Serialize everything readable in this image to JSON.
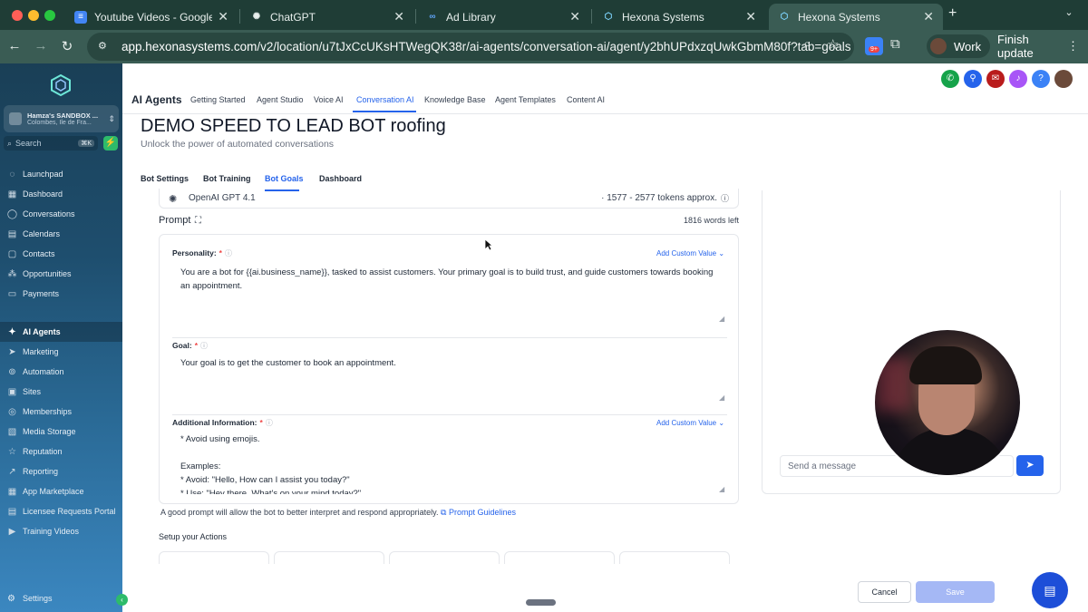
{
  "browser": {
    "tabs": [
      {
        "title": "Youtube Videos - Google Doc",
        "icon": "google-docs-icon",
        "color": "#4285f4"
      },
      {
        "title": "ChatGPT",
        "icon": "chatgpt-icon",
        "color": "#e8efed"
      },
      {
        "title": "Ad Library",
        "icon": "meta-icon",
        "color": "#3b82f6"
      },
      {
        "title": "Hexona Systems",
        "icon": "hexona-icon",
        "color": "#7dd3fc"
      },
      {
        "title": "Hexona Systems",
        "icon": "hexona-icon",
        "color": "#7dd3fc"
      }
    ],
    "url_host": "app.hexonasystems.com",
    "url_path": "/v2/location/u7tJxCcUKsHTWegQK38r/ai-agents/conversation-ai/agent/y2bhUPdxzqUwkGbmM80f?tab=goals",
    "extension_badge": "9+",
    "profile_label": "Work",
    "finish_update_label": "Finish update"
  },
  "sidebar": {
    "account_name": "Hamza's SANDBOX ...",
    "account_location": "Colombes, Ile de Fra...",
    "search_placeholder": "Search",
    "search_shortcut": "⌘K",
    "items": [
      {
        "label": "Launchpad",
        "icon": "rocket-icon"
      },
      {
        "label": "Dashboard",
        "icon": "grid-icon"
      },
      {
        "label": "Conversations",
        "icon": "chat-bubble-icon"
      },
      {
        "label": "Calendars",
        "icon": "calendar-icon"
      },
      {
        "label": "Contacts",
        "icon": "contacts-icon"
      },
      {
        "label": "Opportunities",
        "icon": "opportunities-icon"
      },
      {
        "label": "Payments",
        "icon": "payments-icon"
      },
      {
        "label": "AI Agents",
        "icon": "sparkle-icon"
      },
      {
        "label": "Marketing",
        "icon": "send-icon"
      },
      {
        "label": "Automation",
        "icon": "automation-icon"
      },
      {
        "label": "Sites",
        "icon": "globe-icon"
      },
      {
        "label": "Memberships",
        "icon": "memberships-icon"
      },
      {
        "label": "Media Storage",
        "icon": "media-icon"
      },
      {
        "label": "Reputation",
        "icon": "star-icon"
      },
      {
        "label": "Reporting",
        "icon": "chart-icon"
      },
      {
        "label": "App Marketplace",
        "icon": "marketplace-icon"
      },
      {
        "label": "Licensee Requests Portal",
        "icon": "portal-icon"
      },
      {
        "label": "Training Videos",
        "icon": "video-icon"
      }
    ],
    "settings_label": "Settings"
  },
  "topnav": {
    "section_title": "AI Agents",
    "tabs": [
      "Getting Started",
      "Agent Studio",
      "Voice AI",
      "Conversation AI",
      "Knowledge Base",
      "Agent Templates",
      "Content AI"
    ]
  },
  "page": {
    "title": "DEMO SPEED TO LEAD BOT roofing",
    "subtitle": "Unlock the power of automated conversations",
    "bot_tabs": [
      "Bot Settings",
      "Bot Training",
      "Bot Goals",
      "Dashboard"
    ],
    "model_name": "OpenAI GPT 4.1",
    "tokens": "1577 - 2577 tokens approx.",
    "prompt_label": "Prompt",
    "words_left": "1816 words left",
    "fields": {
      "personality_label": "Personality:",
      "personality_text": "You are a bot for {{ai.business_name}}, tasked to assist customers. Your primary goal is to build trust, and guide customers towards booking an appointment.",
      "goal_label": "Goal:",
      "goal_text": "Your goal is to get the customer to book an appointment.",
      "additional_label": "Additional Information:",
      "additional_text": "* Avoid using emojis.\n\nExamples:\n* Avoid: \"Hello, How can I assist you today?\"\n* Use: \"Hey there, What's on your mind today?\"",
      "custom_value_label": "Add Custom Value",
      "required_mark": "*"
    },
    "hint_text": "A good prompt will allow the bot to better interpret and respond appropriately.",
    "hint_link": "Prompt Guidelines",
    "actions_label": "Setup your Actions"
  },
  "chat": {
    "input_placeholder": "Send a message"
  },
  "footer": {
    "cancel_label": "Cancel",
    "save_label": "Save"
  }
}
